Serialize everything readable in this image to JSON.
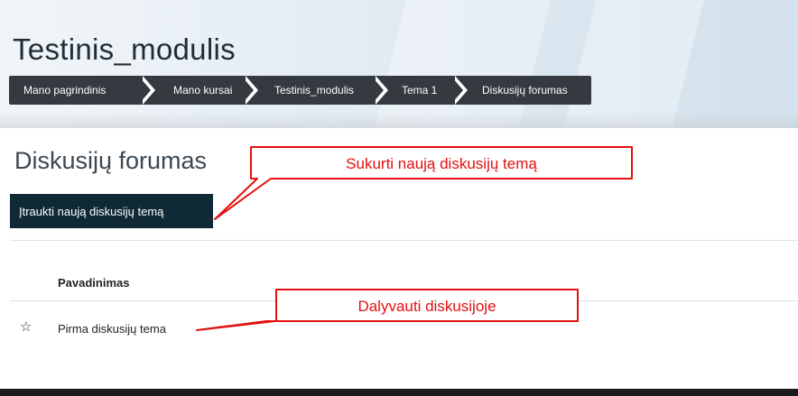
{
  "header": {
    "course_title": "Testinis_modulis"
  },
  "breadcrumb": [
    {
      "label": "Mano pagrindinis"
    },
    {
      "label": "Mano kursai"
    },
    {
      "label": "Testinis_modulis"
    },
    {
      "label": "Tema 1"
    },
    {
      "label": "Diskusijų forumas"
    }
  ],
  "main": {
    "page_title": "Diskusijų forumas",
    "add_topic_button": "Įtraukti naują diskusijų temą",
    "table": {
      "column_header": "Pavadinimas",
      "rows": [
        {
          "title": "Pirma diskusijų tema",
          "icon": "star-icon"
        }
      ]
    }
  },
  "annotations": {
    "create_topic": "Sukurti naują diskusijų temą",
    "participate": "Dalyvauti diskusijoje",
    "color": "#e21010"
  }
}
